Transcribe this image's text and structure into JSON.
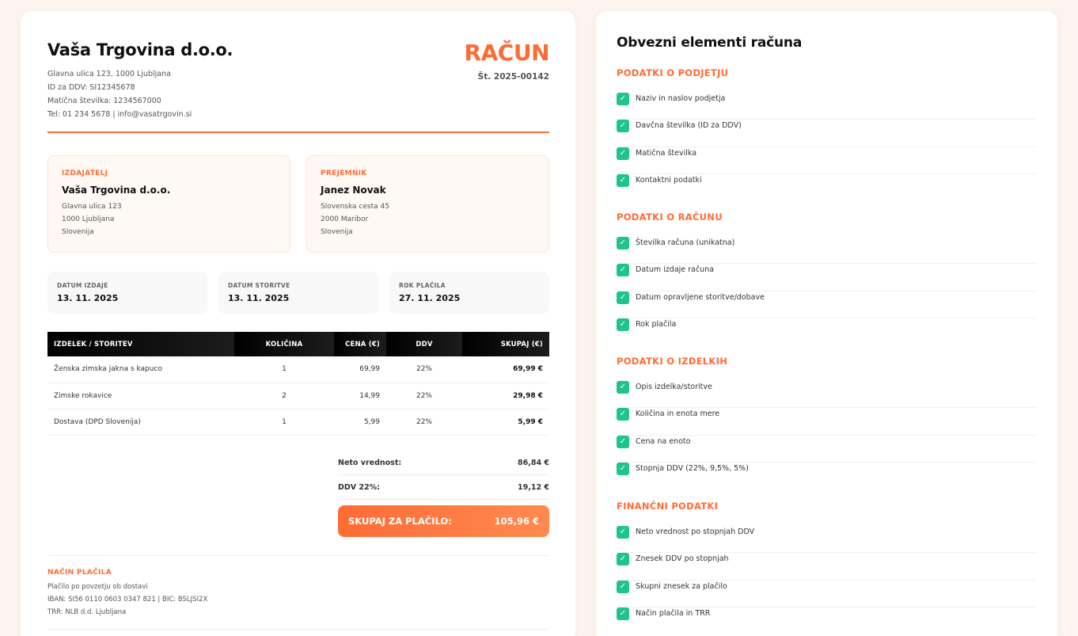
{
  "invoice": {
    "company_name": "Vaša Trgovina d.o.o.",
    "company_lines": [
      "Glavna ulica 123, 1000 Ljubljana",
      "ID za DDV: SI12345678",
      "Matična številka: 1234567000",
      "Tel: 01 234 5678 | info@vasatrgovin.si"
    ],
    "doc_title": "RAČUN",
    "doc_number": "Št. 2025-00142",
    "issuer": {
      "label": "IZDAJATELJ",
      "name": "Vaša Trgovina d.o.o.",
      "lines": [
        "Glavna ulica 123",
        "1000 Ljubljana",
        "Slovenija"
      ]
    },
    "recipient": {
      "label": "PREJEMNIK",
      "name": "Janez Novak",
      "lines": [
        "Slovenska cesta 45",
        "2000 Maribor",
        "Slovenija"
      ]
    },
    "dates": [
      {
        "label": "DATUM IZDAJE",
        "value": "13. 11. 2025"
      },
      {
        "label": "DATUM STORITVE",
        "value": "13. 11. 2025"
      },
      {
        "label": "ROK PLAČILA",
        "value": "27. 11. 2025"
      }
    ],
    "table": {
      "headers": [
        "IZDELEK / STORITEV",
        "KOLIČINA",
        "CENA (€)",
        "DDV",
        "SKUPAJ (€)"
      ],
      "rows": [
        [
          "Ženska zimska jakna s kapuco",
          "1",
          "69,99",
          "22%",
          "69,99 €"
        ],
        [
          "Zimske rokavice",
          "2",
          "14,99",
          "22%",
          "29,98 €"
        ],
        [
          "Dostava (DPD Slovenija)",
          "1",
          "5,99",
          "22%",
          "5,99 €"
        ]
      ]
    },
    "totals": {
      "net_label": "Neto vrednost:",
      "net_value": "86,84 €",
      "vat_label": "DDV 22%:",
      "vat_value": "19,12 €",
      "grand_label": "SKUPAJ ZA PLAČILO:",
      "grand_value": "105,96 €"
    },
    "payment": {
      "label": "NAČIN PLAČILA",
      "lines": [
        "Plačilo po povzetju ob dostavi",
        "IBAN: SI56 0110 0603 0347 821 | BIC: BSLJSI2X",
        "TRR: NLB d.d. Ljubljana"
      ]
    }
  },
  "checklist": {
    "title": "Obvezni elementi računa",
    "sections": [
      {
        "heading": "PODATKI O PODJETJU",
        "items": [
          "Naziv in naslov podjetja",
          "Davčna številka (ID za DDV)",
          "Matična številka",
          "Kontaktni podatki"
        ]
      },
      {
        "heading": "PODATKI O RAČUNU",
        "items": [
          "Številka računa (unikatna)",
          "Datum izdaje računa",
          "Datum opravljene storitve/dobave",
          "Rok plačila"
        ]
      },
      {
        "heading": "PODATKI O IZDELKIH",
        "items": [
          "Opis izdelka/storitve",
          "Količina in enota mere",
          "Cena na enoto",
          "Stopnja DDV (22%, 9,5%, 5%)"
        ]
      },
      {
        "heading": "FINANČNI PODATKI",
        "items": [
          "Neto vrednost po stopnjah DDV",
          "Znesek DDV po stopnjah",
          "Skupni znesek za plačilo",
          "Način plačila in TRR"
        ]
      }
    ]
  },
  "colors": {
    "accent": "#ff6b35",
    "check": "#1fc48b",
    "header_dark": "#000000"
  }
}
